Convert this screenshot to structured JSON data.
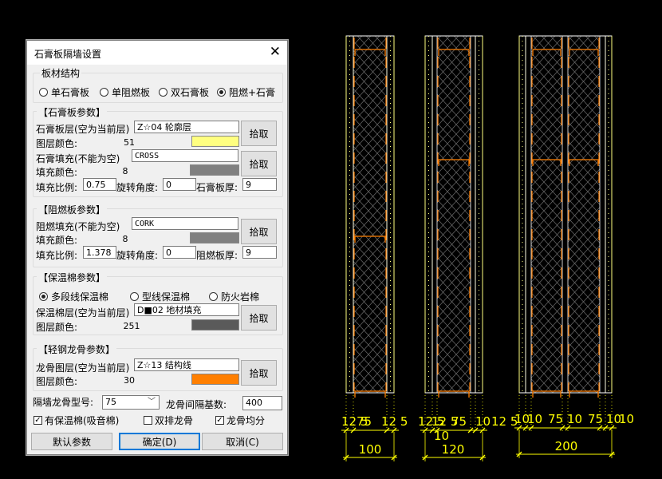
{
  "dialog": {
    "title": "石膏板隔墙设置",
    "close_glyph": "✕",
    "board_structure": {
      "legend": "板材结构",
      "options": [
        "单石膏板",
        "单阻燃板",
        "双石膏板",
        "阻燃+石膏"
      ],
      "selected": 3
    },
    "gypsum": {
      "legend": "【石膏板参数】",
      "layer_label": "石膏板层(空为当前层)",
      "layer_value": "Z☆04 轮廓层",
      "color_label": "图层颜色:",
      "color_value": "51",
      "color_hex": "#ffff80",
      "fill_label": "石膏填充(不能为空)",
      "fill_value": "CROSS",
      "fill_color_label": "填充颜色:",
      "fill_color_value": "8",
      "fill_color_hex": "#808080",
      "ratio_label": "填充比例:",
      "ratio_value": "0.75",
      "angle_label": "旋转角度:",
      "angle_value": "0",
      "thick_label": "石膏板厚:",
      "thick_value": "9",
      "pick1": "拾取",
      "pick2": "拾取"
    },
    "fireproof": {
      "legend": "【阻燃板参数】",
      "fill_label": "阻燃填充(不能为空)",
      "fill_value": "CORK",
      "fill_color_label": "填充颜色:",
      "fill_color_value": "8",
      "fill_color_hex": "#808080",
      "ratio_label": "填充比例:",
      "ratio_value": "1.378",
      "angle_label": "旋转角度:",
      "angle_value": "0",
      "thick_label": "阻燃板厚:",
      "thick_value": "9",
      "pick": "拾取"
    },
    "insulation": {
      "legend": "【保温棉参数】",
      "options": [
        "多段线保温棉",
        "型线保温棉",
        "防火岩棉"
      ],
      "selected": 0,
      "layer_label": "保温棉层(空为当前层)",
      "layer_value": "D■02 地材填充",
      "color_label": "图层颜色:",
      "color_value": "251",
      "color_hex": "#5a5a5a",
      "pick": "拾取"
    },
    "keel": {
      "legend": "【轻钢龙骨参数】",
      "layer_label": "龙骨图层(空为当前层)",
      "layer_value": "Z☆13 结构线",
      "color_label": "图层颜色:",
      "color_value": "30",
      "color_hex": "#ff7f00",
      "pick": "拾取"
    },
    "keel_type_label": "隔墙龙骨型号:",
    "keel_type_value": "75",
    "keel_spacing_label": "龙骨间隔基数:",
    "keel_spacing_value": "400",
    "checks": [
      {
        "label": "有保温棉(吸音棉)",
        "checked": true
      },
      {
        "label": "双排龙骨",
        "checked": false
      },
      {
        "label": "龙骨均分",
        "checked": true
      }
    ],
    "buttons": {
      "default": "默认参数",
      "ok": "确定(D)",
      "cancel": "取消(C)"
    }
  },
  "drawing": {
    "colors": {
      "board": "#ffff80",
      "frame": "#ffffff",
      "hatch": "#7a7a7a",
      "keel": "#ff7f00",
      "dim": "#ffff00"
    },
    "walls": [
      {
        "parts": [
          "12.5",
          "75",
          "12.5"
        ],
        "total": "100"
      },
      {
        "parts": [
          "12.5",
          "75",
          "10",
          "12.5"
        ],
        "total": "120"
      },
      {
        "parts": [
          "10",
          "10",
          "75",
          "10",
          "75",
          "10",
          "10"
        ],
        "total": "200"
      }
    ]
  }
}
